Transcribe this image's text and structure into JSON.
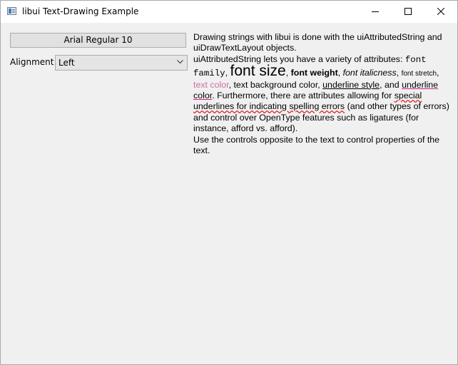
{
  "window": {
    "title": "libui Text-Drawing Example"
  },
  "controls": {
    "font_button_label": "Arial Regular 10",
    "alignment_label": "Alignment",
    "alignment_value": "Left"
  },
  "text": {
    "p1": "Drawing strings with libui is done with the uiAttributedString and uiDrawTextLayout objects.",
    "p2_intro": "uiAttributedString lets you have a variety of attributes: ",
    "font_family": "font family",
    "sep1": ", ",
    "font_size": "font size",
    "sep2": ", ",
    "font_weight": "font weight",
    "sep3": ", ",
    "font_italicness": "font italicness",
    "sep4": ", ",
    "font_stretch": "font stretch",
    "sep5": ", ",
    "text_color": "text color",
    "sep6": ", text background color, ",
    "underline_style": "underline style",
    "sep7": ", and ",
    "underline_color": "underline color",
    "sep8": ". Furthermore, there are attributes allowing for ",
    "special_underlines": "special underlines for indicating spelling errors",
    "sep9": " (and other types of errors) and control over OpenType features such as ligatures (for instance, afford vs. afford).",
    "p3": "Use the controls opposite to the text to control properties of the text."
  },
  "colors": {
    "text_color_sample": "#d06ca9",
    "underline_color_sample": "#d4207e",
    "spelling_error_underline": "#e02020"
  }
}
